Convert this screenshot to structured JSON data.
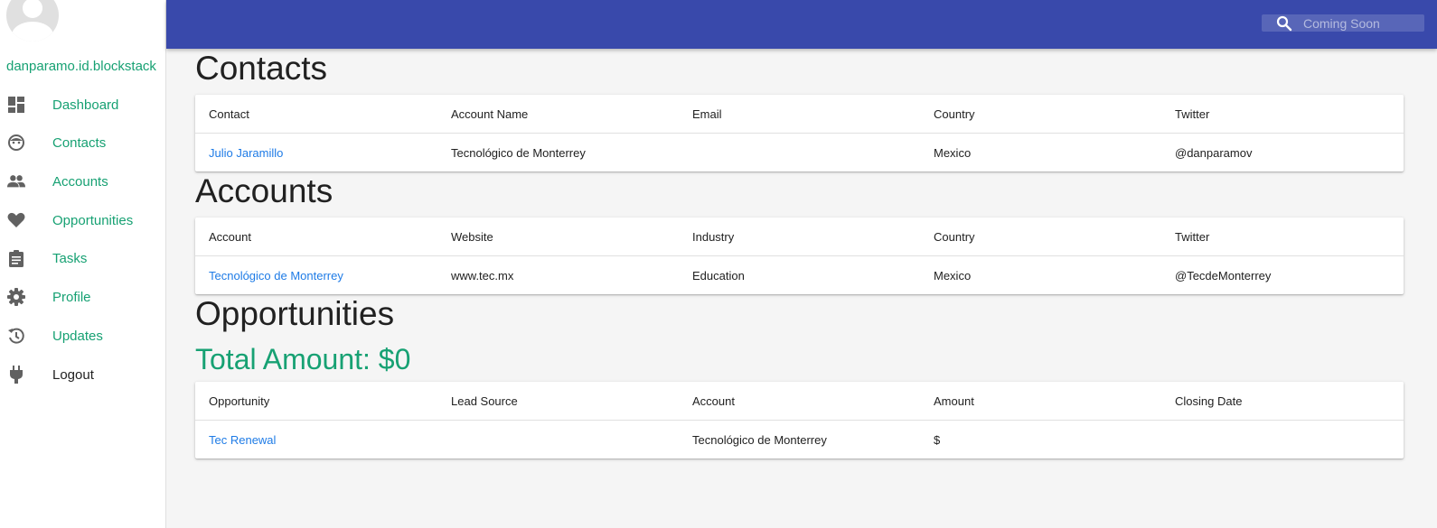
{
  "sidebar": {
    "username": "danparamo.id.blockstack",
    "items": [
      {
        "label": "Dashboard",
        "icon": "dashboard-icon"
      },
      {
        "label": "Contacts",
        "icon": "face-icon"
      },
      {
        "label": "Accounts",
        "icon": "people-icon"
      },
      {
        "label": "Opportunities",
        "icon": "heart-icon"
      },
      {
        "label": "Tasks",
        "icon": "clipboard-icon"
      },
      {
        "label": "Profile",
        "icon": "gear-icon"
      },
      {
        "label": "Updates",
        "icon": "history-icon"
      },
      {
        "label": "Logout",
        "icon": "plug-icon"
      }
    ]
  },
  "topbar": {
    "search_placeholder": "Coming Soon"
  },
  "contacts": {
    "title": "Contacts",
    "columns": [
      "Contact",
      "Account Name",
      "Email",
      "Country",
      "Twitter"
    ],
    "rows": [
      [
        "Julio Jaramillo",
        "Tecnológico de Monterrey",
        "",
        "Mexico",
        "@danparamov"
      ]
    ]
  },
  "accounts": {
    "title": "Accounts",
    "columns": [
      "Account",
      "Website",
      "Industry",
      "Country",
      "Twitter"
    ],
    "rows": [
      [
        "Tecnológico de Monterrey",
        "www.tec.mx",
        "Education",
        "Mexico",
        "@TecdeMonterrey"
      ]
    ]
  },
  "opportunities": {
    "title": "Opportunities",
    "total": "Total Amount: $0",
    "columns": [
      "Opportunity",
      "Lead Source",
      "Account",
      "Amount",
      "Closing Date"
    ],
    "rows": [
      [
        "Tec Renewal",
        "",
        "Tecnológico de Monterrey",
        "$",
        ""
      ]
    ]
  },
  "colors": {
    "topbar": "#3949ab",
    "accent_green": "#17a173",
    "link_blue": "#1e7be6"
  }
}
